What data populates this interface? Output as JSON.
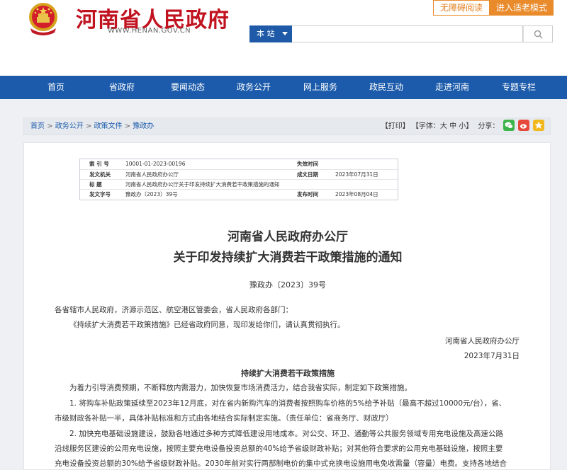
{
  "header": {
    "site_title": "河南省人民政府",
    "site_url": "WWW.HENAN.GOV.CN",
    "btn_accessible": "无障碍阅读",
    "btn_elder": "进入适老模式",
    "search_scope": "本 站",
    "search_placeholder": ""
  },
  "nav": [
    "首页",
    "省政府",
    "要闻动态",
    "政务公开",
    "网上服务",
    "政民互动",
    "走进河南",
    "专题专栏"
  ],
  "breadcrumb": [
    "首页",
    "政务公开",
    "政策文件",
    "豫政办"
  ],
  "tools": {
    "print": "【打印】",
    "font_label": "【字体：大 中 小】",
    "share": "分享："
  },
  "meta": {
    "index_label": "索 引 号",
    "index_value": "10001-01-2023-00196",
    "invalid_label": "失效时间",
    "invalid_value": "",
    "issuer_label": "发文机关",
    "issuer_value": "河南省人民政府办公厅",
    "created_label": "成文日期",
    "created_value": "2023年07月31日",
    "title_label": "标 题",
    "title_value": "河南省人民政府办公厅关于印发持续扩大消费若干政策措施的通知",
    "docno_label": "发文字号",
    "docno_value": "豫政办〔2023〕39号",
    "published_label": "发布时间",
    "published_value": "2023年08月04日"
  },
  "doc": {
    "title_line1": "河南省人民政府办公厅",
    "title_line2": "关于印发持续扩大消费若干政策措施的通知",
    "number": "豫政办〔2023〕39号",
    "addressee": "各省辖市人民政府，济源示范区、航空港区管委会，省人民政府各部门：",
    "intro": "《持续扩大消费若干政策措施》已经省政府同意，现印发给你们，请认真贯彻执行。",
    "signer": "河南省人民政府办公厅",
    "date": "2023年7月31日",
    "subhead": "持续扩大消费若干政策措施",
    "para0": "为着力引导消费预期，不断释放内需潜力，加快恢复市场消费活力，结合我省实际，制定如下政策措施。",
    "para1a": "1. 将购车补贴政策延续至2023年12月底，对在省内新购汽车的消费者按照购车价格的5%给予补贴（最高不超过10000元/台），省、",
    "para1b": "市级财政各补贴一半，具体补贴标准和方式由各地结合实际制定实施。（责任单位：省商务厅、财政厅）",
    "para2a": "2. 加快充电基础设施建设，鼓励各地通过多种方式降低建设用地成本。对公交、环卫、通勤等公共服务领域专用充电设施及高速公路",
    "para2b": "沿线服务区建设的公用充电设施，按照主要充电设备投资总额的40%给予省级财政补贴；对其他符合要求的公用充电基础设施，按照主要",
    "para2c": "充电设备投资总额的30%给予省级财政补贴。2030年前对实行两部制电价的集中式充换电设施用电免收需量（容量）电费。支持各地结合"
  },
  "colors": {
    "brand_red": "#c1121f",
    "nav_blue": "#1c5bab",
    "accent_orange": "#e98a2b"
  }
}
